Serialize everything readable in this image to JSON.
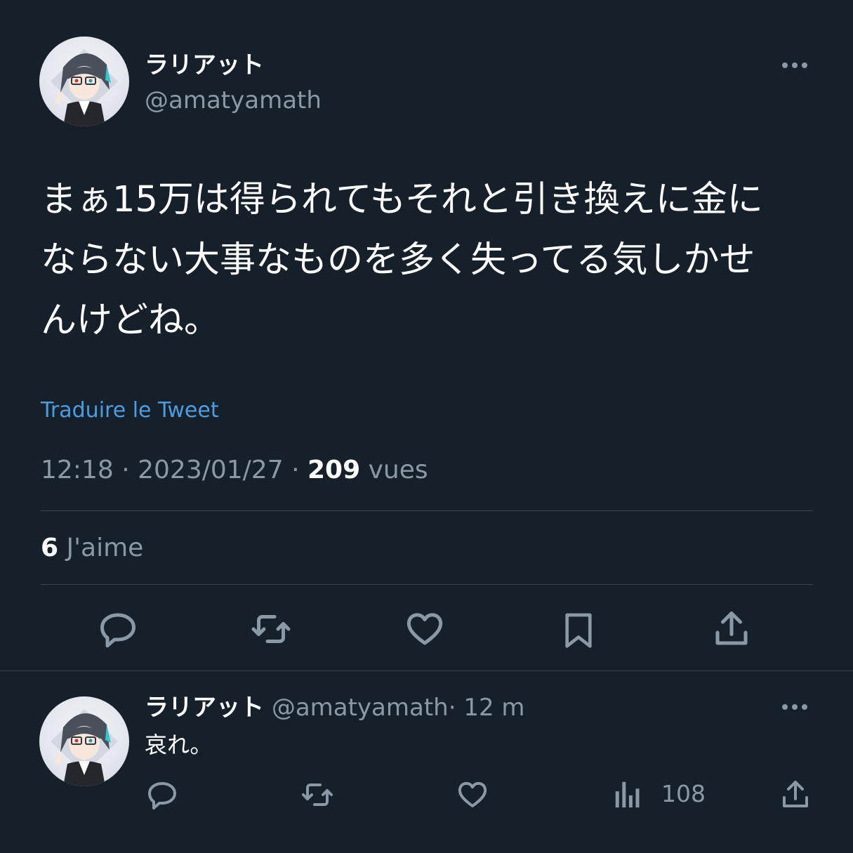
{
  "tweet": {
    "author_name": "ラリアット",
    "author_handle": "@amatyamath",
    "text_lines": [
      "まぁ15万は得られてもそれと引き換えに金に",
      "ならない大事なものを多く失ってる気しかせ",
      "んけどね。"
    ],
    "translate_label": "Traduire le Tweet",
    "time": "12:18",
    "separator": "·",
    "date": "2023/01/27",
    "views_count": "209",
    "views_label": "vues",
    "likes_count": "6",
    "likes_label": "J'aime"
  },
  "reply": {
    "author_name": "ラリアット",
    "author_handle": "@amatyamath",
    "separator": "·",
    "time_ago": "12 m",
    "text": "哀れ。",
    "views_count": "108"
  },
  "icons": [
    "more-icon",
    "reply-icon",
    "retweet-icon",
    "like-icon",
    "bookmark-icon",
    "share-icon",
    "views-icon"
  ],
  "colors": {
    "background": "#16202a",
    "text": "#ffffff",
    "muted": "#8b98a5",
    "link": "#4e9ce0",
    "divider": "#38444d"
  }
}
